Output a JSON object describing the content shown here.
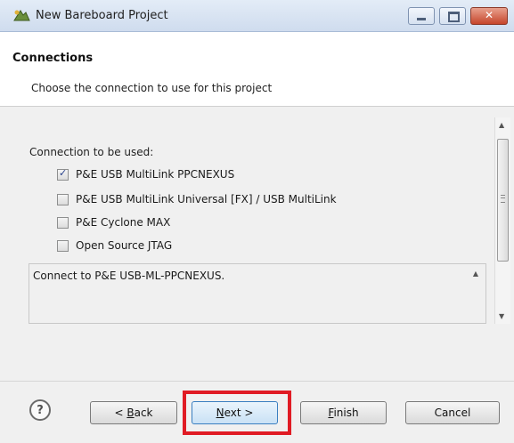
{
  "window": {
    "title": "New Bareboard Project",
    "icon": "project-icon",
    "controls": [
      "minimize",
      "maximize",
      "close"
    ]
  },
  "header": {
    "title": "Connections",
    "description": "Choose the connection to use for this project"
  },
  "connections": {
    "label": "Connection to be used:",
    "options": [
      {
        "label": "P&E USB MultiLink PPCNEXUS",
        "checked": true
      },
      {
        "label": "P&E USB MultiLink Universal [FX] / USB MultiLink",
        "checked": false
      },
      {
        "label": "P&E Cyclone MAX",
        "checked": false
      },
      {
        "label": "Open Source JTAG",
        "checked": false
      }
    ],
    "description": "Connect to P&E USB-ML-PPCNEXUS."
  },
  "footer": {
    "help_icon": "question-mark-icon",
    "back_prefix": "< ",
    "back_mnemonic": "B",
    "back_rest": "ack",
    "next_mnemonic": "N",
    "next_rest": "ext >",
    "finish_mnemonic": "F",
    "finish_rest": "inish",
    "cancel_label": "Cancel",
    "highlight_color": "#e01b24"
  }
}
